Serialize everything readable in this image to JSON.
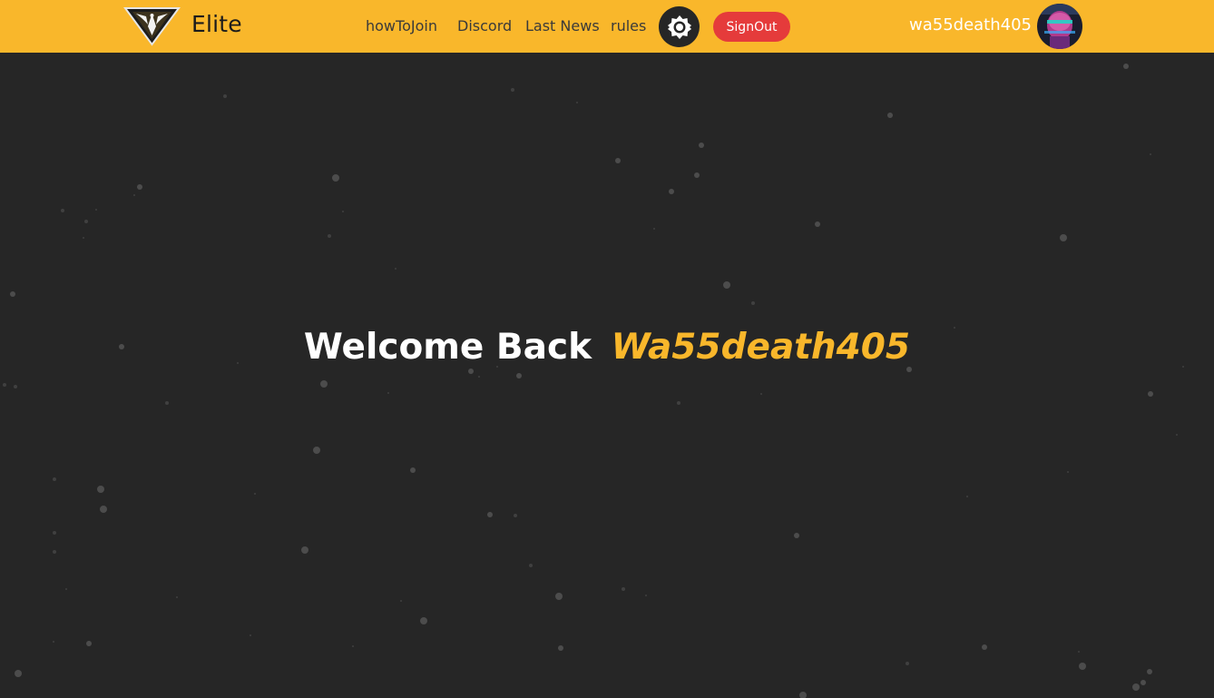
{
  "brand": {
    "name": "Elite"
  },
  "nav": {
    "links": [
      "howToJoin",
      "Discord",
      "Last News",
      "rules"
    ],
    "theme_icon": "brightness-icon",
    "signout_label": "SignOut"
  },
  "user": {
    "name": "wa55death405",
    "avatar_icon": "user-avatar"
  },
  "hero": {
    "greeting": "Welcome Back",
    "username": "Wa55death405"
  },
  "colors": {
    "accent": "#f9b72b",
    "background": "#262626",
    "signout": "#e53b3b"
  }
}
